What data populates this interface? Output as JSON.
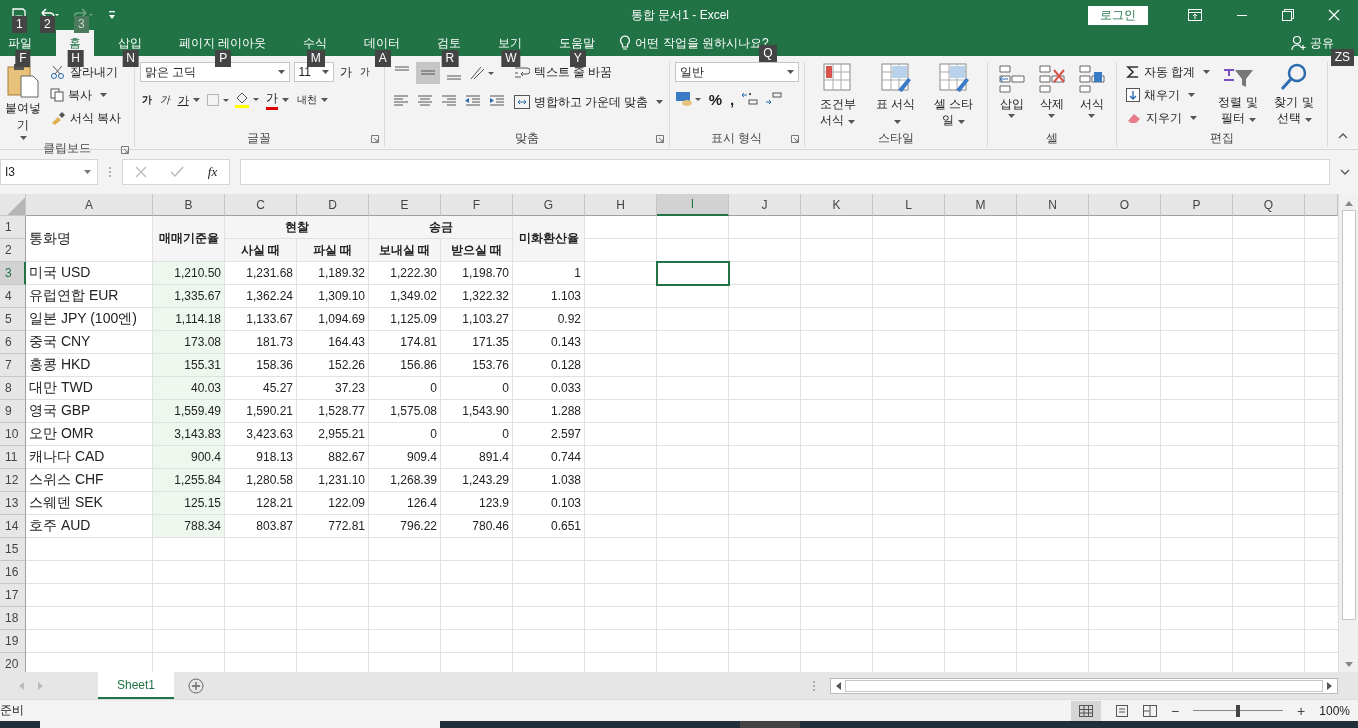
{
  "window": {
    "title": "통합 문서1  -  Excel",
    "login": "로그인"
  },
  "quick_access_keytips": [
    "1",
    "2",
    "3"
  ],
  "tabs": [
    {
      "label": "파일",
      "selected": false,
      "keytip": "F"
    },
    {
      "label": "홈",
      "selected": true,
      "keytip": "H"
    },
    {
      "label": "삽입",
      "selected": false,
      "keytip": "N"
    },
    {
      "label": "페이지 레이아웃",
      "selected": false,
      "keytip": "P"
    },
    {
      "label": "수식",
      "selected": false,
      "keytip": "M"
    },
    {
      "label": "데이터",
      "selected": false,
      "keytip": "A"
    },
    {
      "label": "검토",
      "selected": false,
      "keytip": "R"
    },
    {
      "label": "보기",
      "selected": false,
      "keytip": "W"
    },
    {
      "label": "도움말",
      "selected": false,
      "keytip": "Y"
    }
  ],
  "tell_me": {
    "label": "어떤 작업을 원하시나요?",
    "keytip": "Q"
  },
  "share": {
    "label": "공유",
    "keytip": "ZS"
  },
  "ribbon": {
    "clipboard": {
      "label": "클립보드",
      "paste": "붙여넣기",
      "cut": "잘라내기",
      "copy": "복사",
      "format_painter": "서식 복사"
    },
    "font": {
      "label": "글꼴",
      "font_name": "맑은 고딕",
      "font_size": "11",
      "grow": "가",
      "shrink": "가",
      "bold": "가",
      "italic": "가",
      "underline": "가",
      "font_color": "가",
      "phonetic": "내천"
    },
    "alignment": {
      "label": "맞춤",
      "vertical_align": [
        {
          "selected": false
        },
        {
          "selected": true
        },
        {
          "selected": false
        }
      ],
      "wrap_text": "텍스트 줄 바꿈",
      "merge_center": "병합하고 가운데 맞춤"
    },
    "number": {
      "label": "표시 형식",
      "format": "일반",
      "percent": "%",
      "comma": ","
    },
    "styles": {
      "label": "스타일",
      "buttons": [
        "조건부 서식",
        "표 서식",
        "셀 스타일"
      ]
    },
    "cells": {
      "label": "셀",
      "buttons": [
        "삽입",
        "삭제",
        "서식"
      ]
    },
    "editing": {
      "label": "편집",
      "autosum": "자동 합계",
      "fill": "채우기",
      "clear": "지우기",
      "sort_filter": "정렬 및 필터",
      "find_select": "찾기 및 선택"
    }
  },
  "formula_bar": {
    "name_box": "I3",
    "function_button": "fx"
  },
  "sheet": {
    "columns": [
      {
        "label": "A",
        "selected": false
      },
      {
        "label": "B",
        "selected": false
      },
      {
        "label": "C",
        "selected": false
      },
      {
        "label": "D",
        "selected": false
      },
      {
        "label": "E",
        "selected": false
      },
      {
        "label": "F",
        "selected": false
      },
      {
        "label": "G",
        "selected": false
      },
      {
        "label": "H",
        "selected": false
      },
      {
        "label": "I",
        "selected": true
      },
      {
        "label": "J",
        "selected": false
      },
      {
        "label": "K",
        "selected": false
      },
      {
        "label": "L",
        "selected": false
      },
      {
        "label": "M",
        "selected": false
      },
      {
        "label": "N",
        "selected": false
      },
      {
        "label": "O",
        "selected": false
      },
      {
        "label": "P",
        "selected": false
      },
      {
        "label": "Q",
        "selected": false
      }
    ],
    "row_numbers": [
      {
        "label": "1",
        "selected": false
      },
      {
        "label": "2",
        "selected": false
      },
      {
        "label": "3",
        "selected": true
      },
      {
        "label": "4",
        "selected": false
      },
      {
        "label": "5",
        "selected": false
      },
      {
        "label": "6",
        "selected": false
      },
      {
        "label": "7",
        "selected": false
      },
      {
        "label": "8",
        "selected": false
      },
      {
        "label": "9",
        "selected": false
      },
      {
        "label": "10",
        "selected": false
      },
      {
        "label": "11",
        "selected": false
      },
      {
        "label": "12",
        "selected": false
      },
      {
        "label": "13",
        "selected": false
      },
      {
        "label": "14",
        "selected": false
      },
      {
        "label": "15",
        "selected": false
      },
      {
        "label": "16",
        "selected": false
      },
      {
        "label": "17",
        "selected": false
      },
      {
        "label": "18",
        "selected": false
      },
      {
        "label": "19",
        "selected": false
      },
      {
        "label": "20",
        "selected": false
      }
    ],
    "header": {
      "currency": "통화명",
      "base_rate": "매매기준율",
      "cash": {
        "label": "현찰",
        "buy": "사실 때",
        "sell": "파실 때"
      },
      "remittance": {
        "label": "송금",
        "send": "보내실 때",
        "receive": "받으실 때"
      },
      "usd_rate": "미화환산율"
    },
    "rows": [
      [
        "미국 USD",
        "1,210.50",
        "1,231.68",
        "1,189.32",
        "1,222.30",
        "1,198.70",
        "1"
      ],
      [
        "유럽연합 EUR",
        "1,335.67",
        "1,362.24",
        "1,309.10",
        "1,349.02",
        "1,322.32",
        "1.103"
      ],
      [
        "일본 JPY (100엔)",
        "1,114.18",
        "1,133.67",
        "1,094.69",
        "1,125.09",
        "1,103.27",
        "0.92"
      ],
      [
        "중국 CNY",
        "173.08",
        "181.73",
        "164.43",
        "174.81",
        "171.35",
        "0.143"
      ],
      [
        "홍콩 HKD",
        "155.31",
        "158.36",
        "152.26",
        "156.86",
        "153.76",
        "0.128"
      ],
      [
        "대만 TWD",
        "40.03",
        "45.27",
        "37.23",
        "0",
        "0",
        "0.033"
      ],
      [
        "영국 GBP",
        "1,559.49",
        "1,590.21",
        "1,528.77",
        "1,575.08",
        "1,543.90",
        "1.288"
      ],
      [
        "오만 OMR",
        "3,143.83",
        "3,423.63",
        "2,955.21",
        "0",
        "0",
        "2.597"
      ],
      [
        "캐나다 CAD",
        "900.4",
        "918.13",
        "882.67",
        "909.4",
        "891.4",
        "0.744"
      ],
      [
        "스위스 CHF",
        "1,255.84",
        "1,280.58",
        "1,231.10",
        "1,268.39",
        "1,243.29",
        "1.038"
      ],
      [
        "스웨덴 SEK",
        "125.15",
        "128.21",
        "122.09",
        "126.4",
        "123.9",
        "0.103"
      ],
      [
        "호주 AUD",
        "788.34",
        "803.87",
        "772.81",
        "796.22",
        "780.46",
        "0.651"
      ]
    ]
  },
  "sheet_tabs": [
    {
      "label": "Sheet1",
      "selected": true
    }
  ],
  "status_bar": {
    "status": "준비",
    "zoom_out": "−",
    "zoom_in": "+",
    "zoom": {
      "level": 0.5
    },
    "zoom_label": "100%"
  }
}
